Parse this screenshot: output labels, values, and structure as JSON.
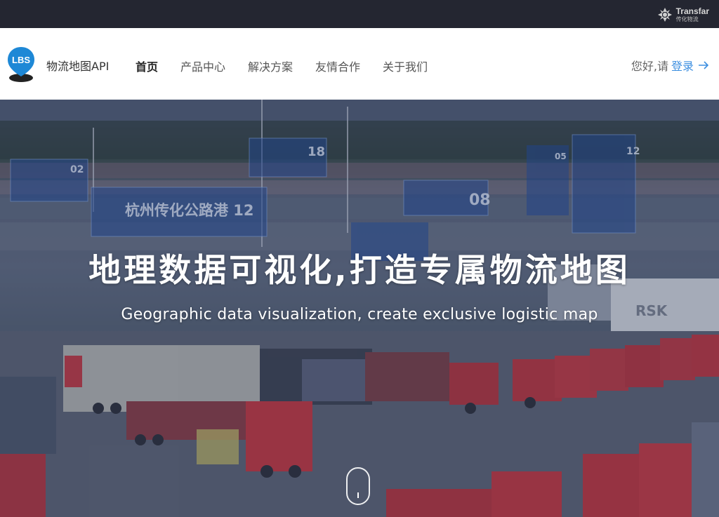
{
  "topbar": {
    "brand_en": "Transfar",
    "brand_cn": "传化物流"
  },
  "header": {
    "logo_text": "LBS",
    "site_name": "物流地图API",
    "nav": [
      {
        "label": "首页",
        "active": true
      },
      {
        "label": "产品中心",
        "active": false
      },
      {
        "label": "解决方案",
        "active": false
      },
      {
        "label": "友情合作",
        "active": false
      },
      {
        "label": "关于我们",
        "active": false
      }
    ],
    "greeting": "您好,请",
    "login_label": "登录",
    "accent_color": "#3d8fe0"
  },
  "hero": {
    "title": "地理数据可视化,打造专属物流地图",
    "subtitle": "Geographic data visualization, create exclusive logistic map",
    "background_labels": [
      "杭州传化公路港 12",
      "18",
      "02",
      "08",
      "05",
      "12",
      "RSK"
    ]
  }
}
